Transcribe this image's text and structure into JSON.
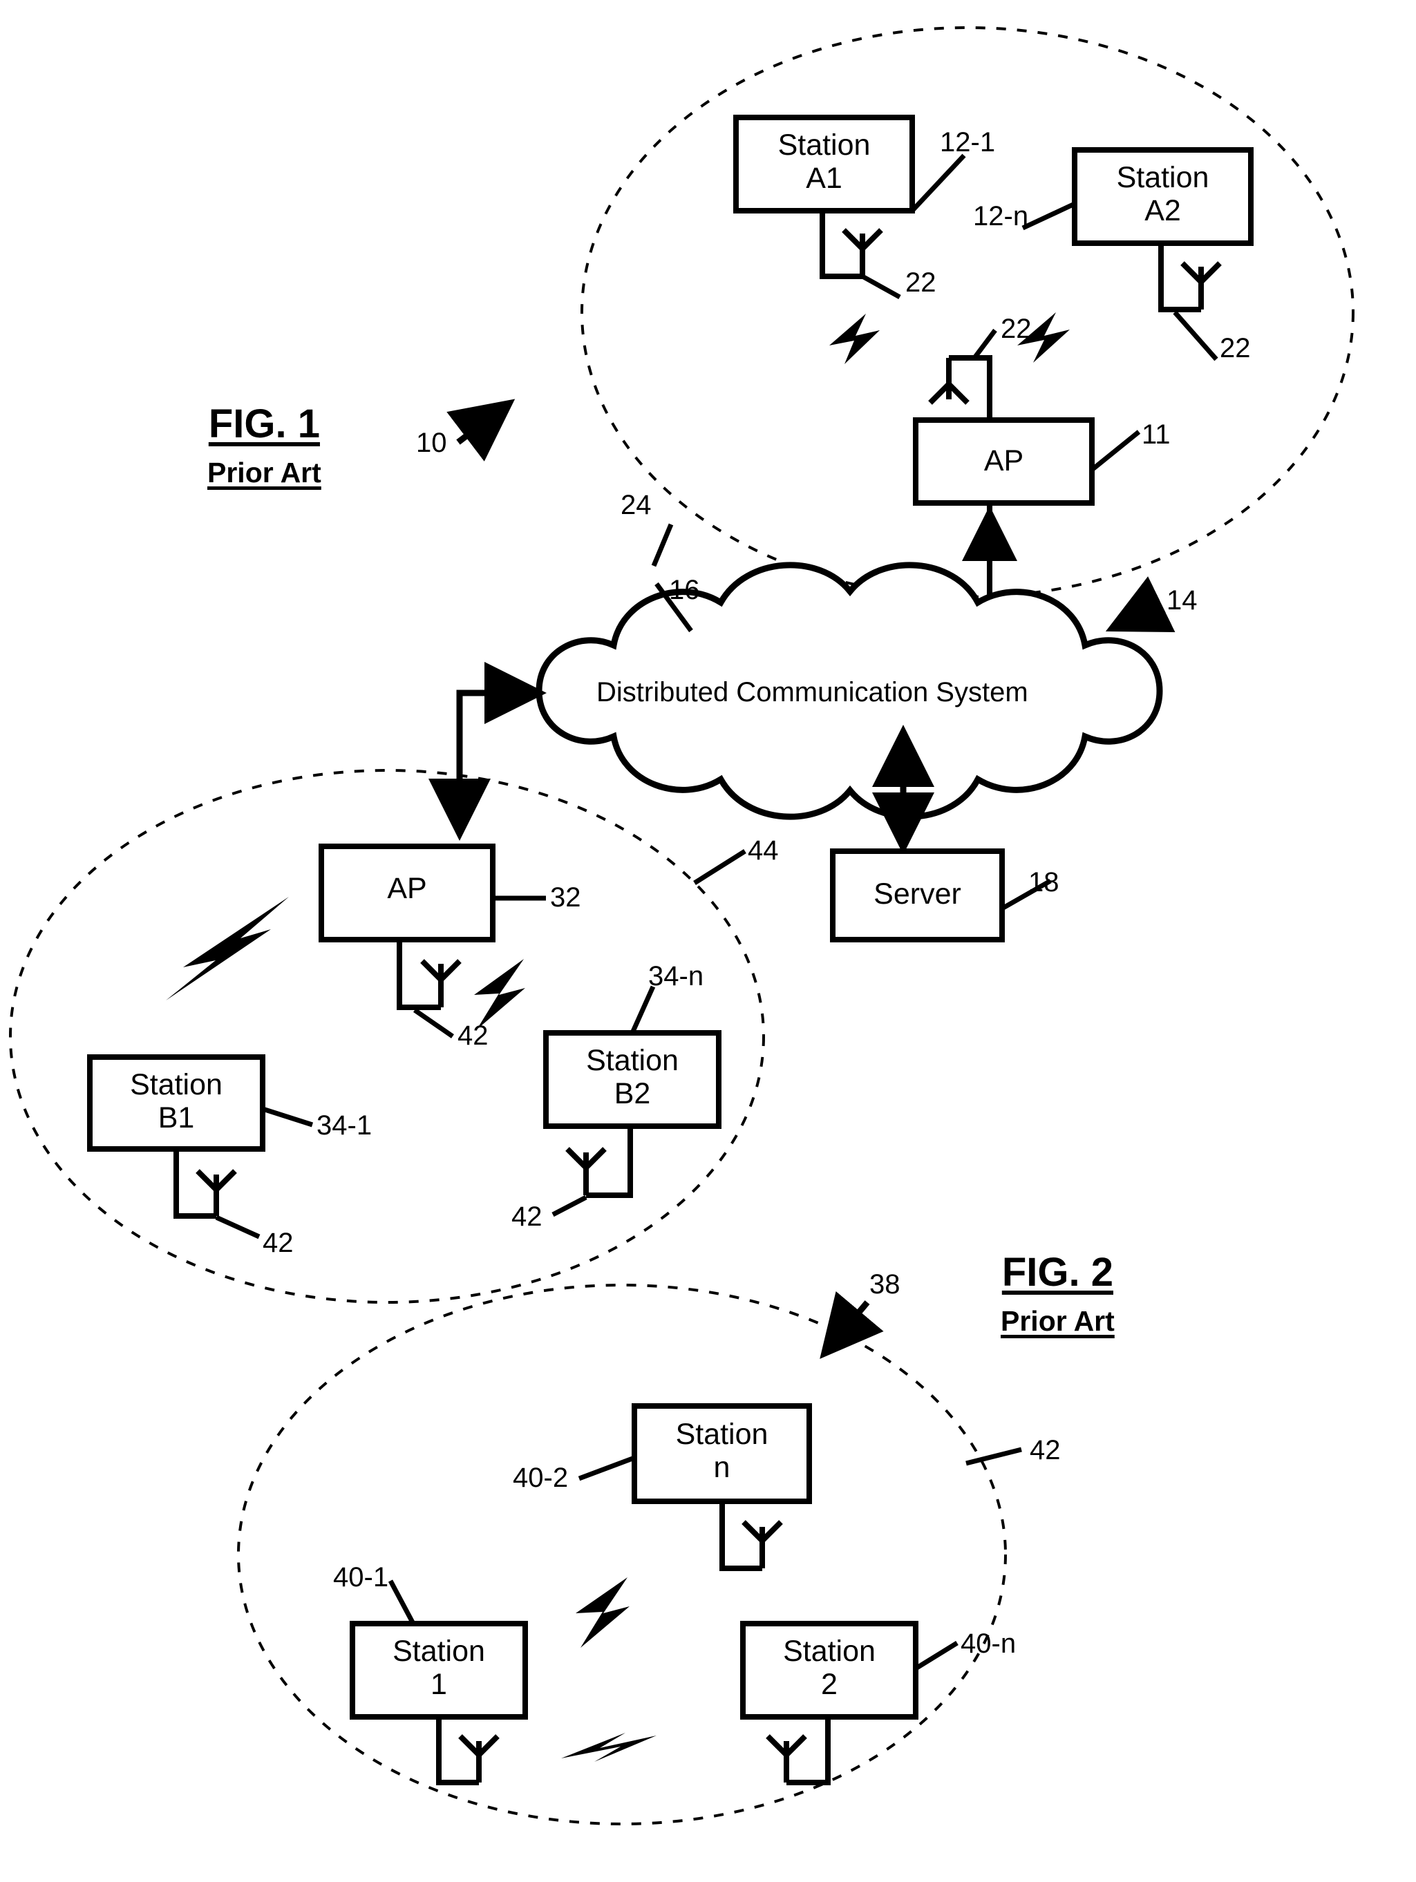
{
  "figures": [
    {
      "id": "fig1",
      "title": "FIG. 1",
      "subtitle": "Prior Art",
      "system_ref": "10",
      "infra_ref": "14",
      "cloud": {
        "label": "Distributed Communication System",
        "ref": "16"
      },
      "server": {
        "label": "Server",
        "ref": "18"
      },
      "bss_a": {
        "ref": "24",
        "ap": {
          "label": "AP",
          "ref": "11",
          "antenna_ref": "22"
        },
        "stations": [
          {
            "line1": "Station",
            "line2": "A1",
            "ref": "12-1",
            "antenna_ref": "22"
          },
          {
            "line1": "Station",
            "line2": "A2",
            "ref": "12-n",
            "antenna_ref": "22"
          }
        ]
      },
      "bss_b": {
        "ref": "44",
        "ap": {
          "label": "AP",
          "ref": "32",
          "antenna_ref": "42"
        },
        "stations": [
          {
            "line1": "Station",
            "line2": "B1",
            "ref": "34-1",
            "antenna_ref": "42"
          },
          {
            "line1": "Station",
            "line2": "B2",
            "ref": "34-n",
            "antenna_ref": "42"
          }
        ]
      }
    },
    {
      "id": "fig2",
      "title": "FIG. 2",
      "subtitle": "Prior Art",
      "network_ref": "38",
      "ibss": {
        "ref": "42",
        "stations": [
          {
            "line1": "Station",
            "line2": "n",
            "ref": "40-2"
          },
          {
            "line1": "Station",
            "line2": "1",
            "ref": "40-1"
          },
          {
            "line1": "Station",
            "line2": "2",
            "ref": "40-n"
          }
        ]
      }
    }
  ],
  "labels": {
    "ref_10": "10",
    "ref_14": "14",
    "ref_16": "16",
    "ref_18": "18",
    "ref_24": "24",
    "ref_44": "44",
    "ref_38": "38",
    "ref_11": "11",
    "ref_32": "32",
    "ref_12_1": "12-1",
    "ref_12_n": "12-n",
    "ref_34_1": "34-1",
    "ref_34_n": "34-n",
    "ref_40_1": "40-1",
    "ref_40_2": "40-2",
    "ref_40_n": "40-n",
    "ref_42_oval": "42",
    "ant_22_a": "22",
    "ant_22_b": "22",
    "ant_22_c": "22",
    "ant_22_d": "22",
    "ant_42_a": "42",
    "ant_42_b": "42",
    "ant_42_c": "42"
  },
  "colors": {
    "ink": "#000000",
    "paper": "#ffffff"
  }
}
